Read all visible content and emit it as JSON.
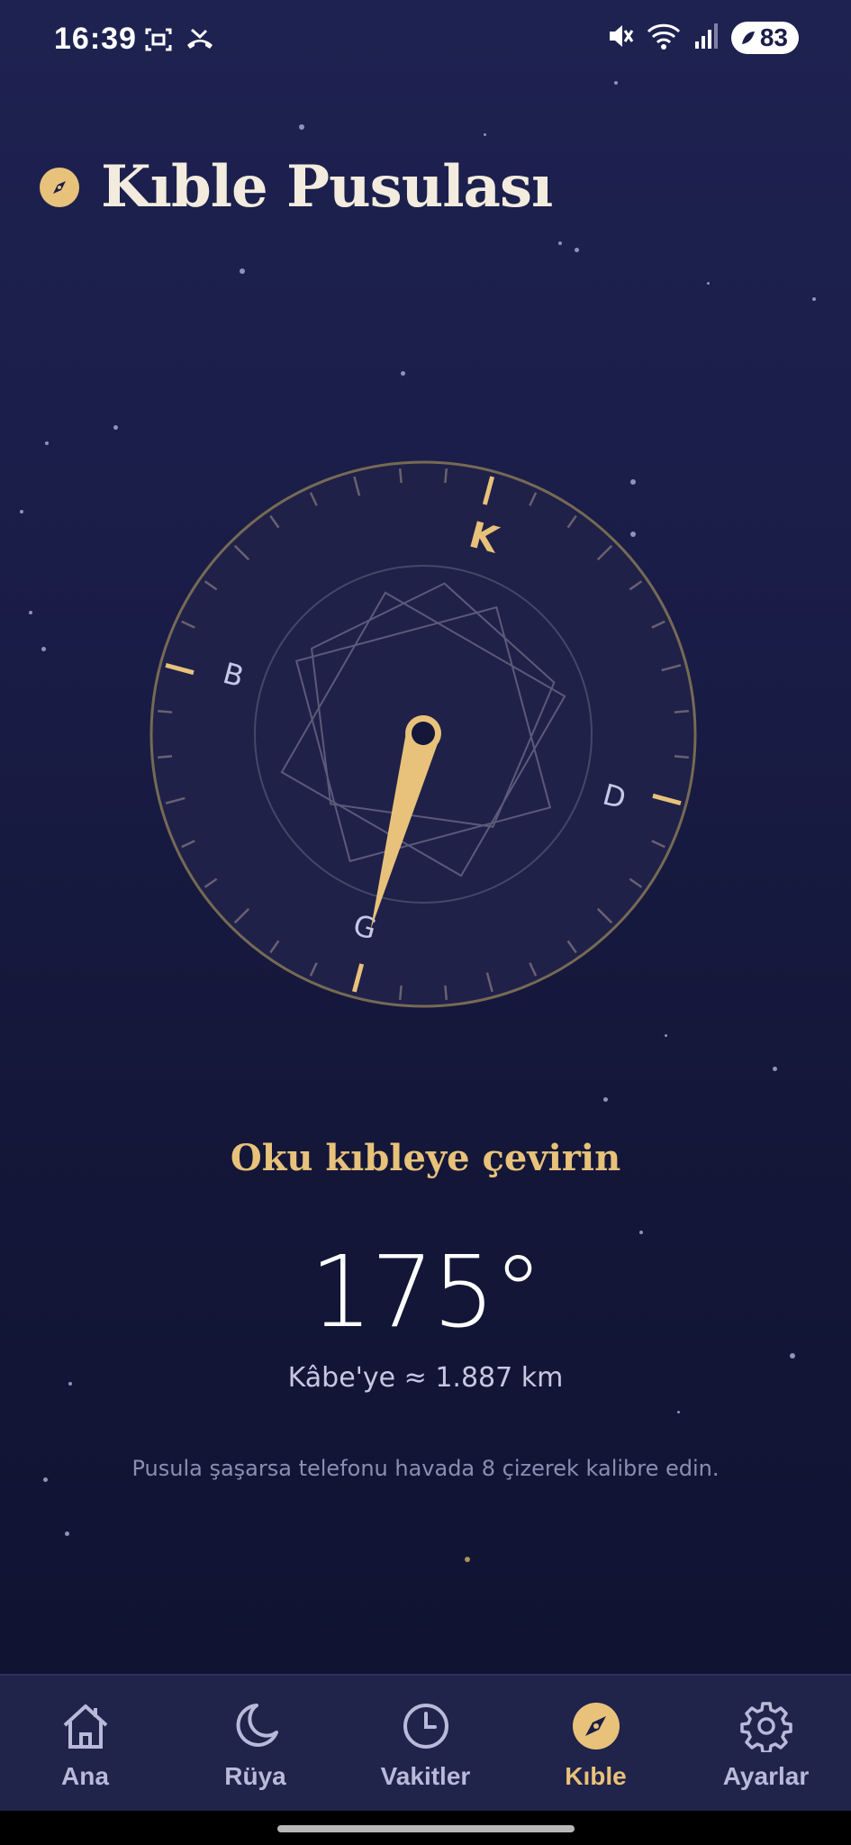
{
  "status": {
    "time": "16:39",
    "battery": "83"
  },
  "header": {
    "title": "Kıble Pusulası",
    "icon": "compass-icon"
  },
  "compass": {
    "labels": {
      "north": "K",
      "east": "D",
      "south": "G",
      "west": "B"
    },
    "needle_bearing_deg": 195,
    "accent": "#e8c27a"
  },
  "qibla": {
    "instruction": "Oku kıbleye çevirin",
    "degrees": "175°",
    "distance": "Kâbe'ye ≈ 1.887 km",
    "hint": "Pusula şaşarsa telefonu havada 8 çizerek kalibre edin."
  },
  "nav": {
    "items": [
      {
        "label": "Ana",
        "icon": "home-icon"
      },
      {
        "label": "Rüya",
        "icon": "moon-icon"
      },
      {
        "label": "Vakitler",
        "icon": "clock-icon"
      },
      {
        "label": "Kıble",
        "icon": "compass-icon"
      },
      {
        "label": "Ayarlar",
        "icon": "gear-icon"
      }
    ],
    "active_index": 3
  },
  "colors": {
    "background": "#1a1d48",
    "accent": "#e8c27a",
    "muted": "#b7bbd9"
  }
}
